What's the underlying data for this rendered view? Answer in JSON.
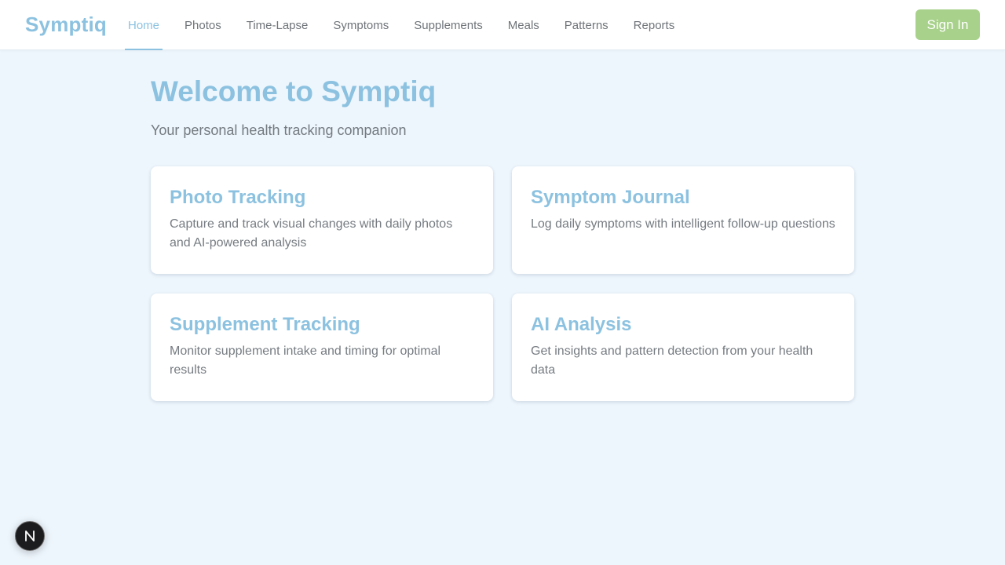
{
  "app": {
    "brand": "Symptiq"
  },
  "nav": {
    "items": [
      {
        "label": "Home",
        "active": true
      },
      {
        "label": "Photos"
      },
      {
        "label": "Time-Lapse"
      },
      {
        "label": "Symptoms"
      },
      {
        "label": "Supplements"
      },
      {
        "label": "Meals"
      },
      {
        "label": "Patterns"
      },
      {
        "label": "Reports"
      }
    ],
    "signin_label": "Sign In"
  },
  "hero": {
    "title": "Welcome to Symptiq",
    "subtitle": "Your personal health tracking companion"
  },
  "features": [
    {
      "title": "Photo Tracking",
      "description": "Capture and track visual changes with daily photos and AI-powered analysis"
    },
    {
      "title": "Symptom Journal",
      "description": "Log daily symptoms with intelligent follow-up questions"
    },
    {
      "title": "Supplement Tracking",
      "description": "Monitor supplement intake and timing for optimal results"
    },
    {
      "title": "AI Analysis",
      "description": "Get insights and pattern detection from your health data"
    }
  ],
  "dev_badge": {
    "icon": "nextjs-logo-icon"
  },
  "colors": {
    "accent": "#8cc2e0",
    "signin": "#a8d18b",
    "background": "#eef6fd",
    "text_muted": "#737a80"
  }
}
